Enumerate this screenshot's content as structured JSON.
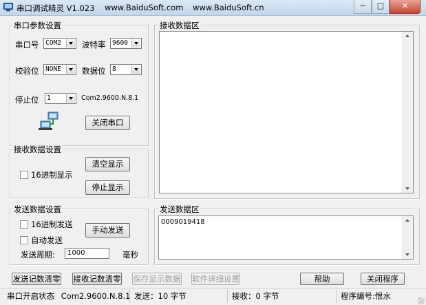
{
  "title": {
    "app": "串口调试精灵 V1.023",
    "site1": "www.BaiduSoft.com",
    "site2": "www.BaiduSoft.cn"
  },
  "window_controls": {
    "minimize": "─",
    "maximize": "□",
    "close": "✕"
  },
  "port_settings": {
    "group_label": "串口参数设置",
    "port_label": "串口号",
    "port_value": "COM2",
    "baud_label": "波特率",
    "baud_value": "9600",
    "parity_label": "校验位",
    "parity_value": "NONE",
    "databits_label": "数据位",
    "databits_value": "8",
    "stopbits_label": "停止位",
    "stopbits_value": "1",
    "config_summary": "Com2.9600.N.8.1",
    "close_port_label": "关闭串口"
  },
  "receive_settings": {
    "group_label": "接收数据设置",
    "hex_display_label": "16进制显示",
    "clear_display_label": "清空显示",
    "stop_display_label": "停止显示"
  },
  "send_settings": {
    "group_label": "发送数据设置",
    "hex_send_label": "16进制发送",
    "auto_send_label": "自动发送",
    "manual_send_label": "手动发送",
    "period_label": "发送周期:",
    "period_value": "1000",
    "period_unit": "毫秒"
  },
  "receive_area": {
    "label": "接收数据区",
    "content": ""
  },
  "send_area": {
    "label": "发送数据区",
    "content": "0009019418"
  },
  "bottom_buttons": {
    "clear_send_count": "发送记数清零",
    "clear_recv_count": "接收记数清零",
    "save_display": "保存显示数据",
    "software_details": "软件详细设置",
    "help": "帮助",
    "close_program": "关闭程序"
  },
  "status": {
    "port_state_label": "串口开启状态",
    "port_state_value": "Com2.9600.N.8.1",
    "sent": "发送：10 字节",
    "received": "接收：0 字节",
    "program_id": "程序编号:恨水"
  }
}
